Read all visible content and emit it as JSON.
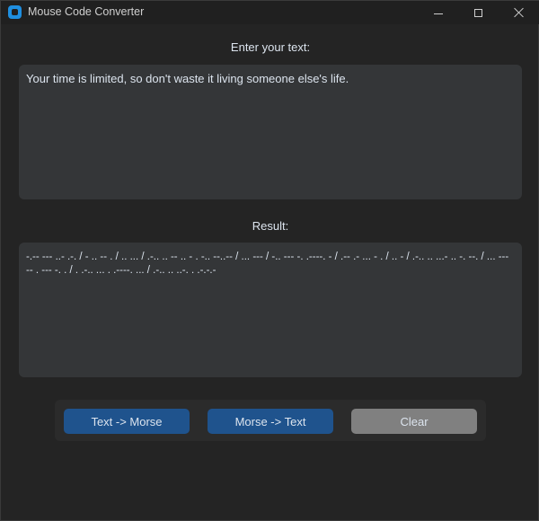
{
  "window": {
    "title": "Mouse Code Converter"
  },
  "input": {
    "label": "Enter your text:",
    "value": "Your time is limited, so don't waste it living someone else's life."
  },
  "result": {
    "label": "Result:",
    "value": "-.-- --- ..- .-. / - .. -- . / .. ... / .-.. .. -- .. - . -.. --..-- / ... --- / -.. --- -. .----. - / .-- .- ... - . / .. - / .-.. .. ...- .. -. --. / ... --- -- . --- -. . / . .-.. ... . .----. ... / .-.. .. ..-. . .-.-.-"
  },
  "buttons": {
    "text_to_morse": "Text -> Morse",
    "morse_to_text": "Morse -> Text",
    "clear": "Clear"
  },
  "colors": {
    "window_bg": "#242424",
    "textbox_bg": "#343638",
    "primary_button": "#1f538d",
    "clear_button": "#808080",
    "app_icon": "#1f8fe0"
  }
}
